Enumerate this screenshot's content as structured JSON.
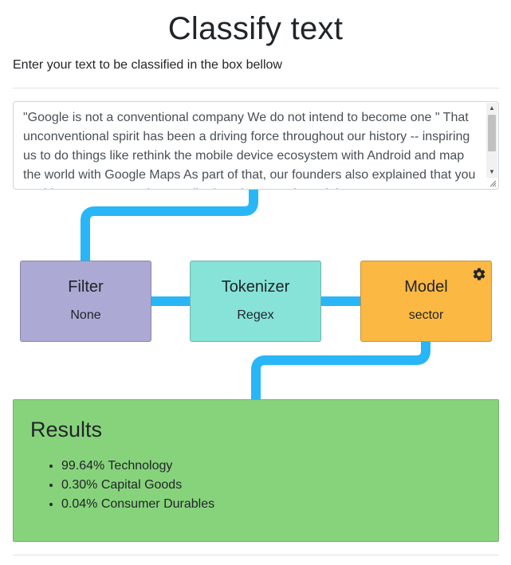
{
  "header": {
    "title": "Classify text",
    "subtitle": "Enter your text to be classified in the box bellow"
  },
  "input": {
    "value": "\"Google is not a conventional company We do not intend to become one \" That unconventional spirit has been a driving force throughout our history -- inspiring us to do things like rethink the mobile device ecosystem with Android and map the world with Google Maps As part of that, our founders also explained that you could expect us to make \"smaller bets in areas that might seem"
  },
  "pipeline": {
    "filter": {
      "title": "Filter",
      "value": "None"
    },
    "tokenizer": {
      "title": "Tokenizer",
      "value": "Regex"
    },
    "model": {
      "title": "Model",
      "value": "sector",
      "settings_icon": "gear-icon"
    }
  },
  "results": {
    "title": "Results",
    "items": [
      "99.64% Technology",
      "0.30% Capital Goods",
      "0.04% Consumer Durables"
    ]
  },
  "colors": {
    "pipe": "#29b6f6",
    "filter": "#aca9d4",
    "tokenizer": "#87e2d7",
    "model": "#fbb843",
    "results": "#87d37c"
  }
}
